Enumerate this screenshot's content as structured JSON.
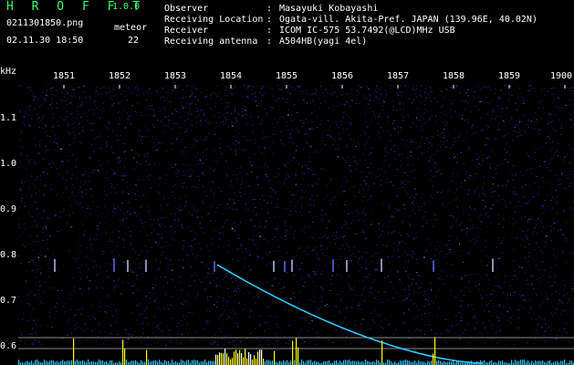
{
  "app": {
    "title": "H R O F F T",
    "version": "1.0.0"
  },
  "info": {
    "file_name": "0211301850.png",
    "meteor_label": "meteor",
    "date_time": "02.11.30 18:50",
    "meteor_count": "22"
  },
  "station": [
    {
      "label": "Observer",
      "sep": ":",
      "value": "Masayuki Kobayashi"
    },
    {
      "label": "Receiving Location",
      "sep": ":",
      "value": "Ogata-vill. Akita-Pref. JAPAN (139.96E, 40.02N)"
    },
    {
      "label": "Receiver",
      "sep": ":",
      "value": "ICOM IC-575 53.7492(@LCD)MHz USB"
    },
    {
      "label": "Receiving antenna",
      "sep": ":",
      "value": "A504HB(yagi 4el)"
    }
  ],
  "spectrogram": {
    "freq_unit": "kHz",
    "time_ticks": [
      "1851",
      "1852",
      "1853",
      "1854",
      "1855",
      "1856",
      "1857",
      "1858",
      "1859",
      "1900"
    ],
    "freq_ticks": [
      "1.1",
      "1.0",
      "0.9",
      "0.8",
      "0.7",
      "0.6"
    ],
    "background_color": "#000000",
    "noise_color": "#2a2aa8",
    "trail_color": "#2ec8ff",
    "signal_color": "#ffff00"
  }
}
